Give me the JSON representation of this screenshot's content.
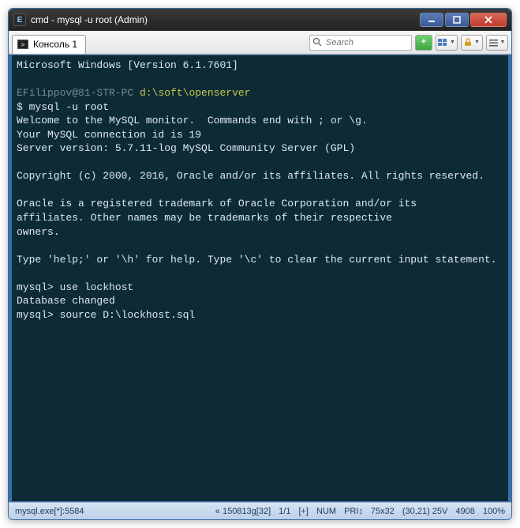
{
  "window": {
    "title": "cmd - mysql  -u root (Admin)"
  },
  "tab": {
    "label": "Консоль 1"
  },
  "search": {
    "placeholder": "Search"
  },
  "terminal": {
    "line_version": "Microsoft Windows [Version 6.1.7601]",
    "user_host": "EFilippov@81-STR-PC",
    "cwd": "d:\\soft\\openserver",
    "cmd1_prefix": "$ ",
    "cmd1": "mysql -u root",
    "welcome1": "Welcome to the MySQL monitor.  Commands end with ; or \\g.",
    "welcome2": "Your MySQL connection id is 19",
    "welcome3": "Server version: 5.7.11-log MySQL Community Server (GPL)",
    "copyright": "Copyright (c) 2000, 2016, Oracle and/or its affiliates. All rights reserved.",
    "trademark1": "Oracle is a registered trademark of Oracle Corporation and/or its",
    "trademark2": "affiliates. Other names may be trademarks of their respective",
    "trademark3": "owners.",
    "help": "Type 'help;' or '\\h' for help. Type '\\c' to clear the current input statement.",
    "p1_prefix": "mysql> ",
    "p1_cmd": "use lockhost",
    "p1_result": "Database changed",
    "p2_prefix": "mysql> ",
    "p2_cmd": "source D:\\lockhost.sql"
  },
  "status": {
    "left": "mysql.exe[*]:5584",
    "encoding": "« 150813g[32]",
    "pos": "1/1",
    "plus": "[+]",
    "num": "NUM",
    "pri": "PRI↕",
    "size": "75x32",
    "coord": "(30,21) 25V",
    "mem": "4908",
    "zoom": "100%"
  }
}
